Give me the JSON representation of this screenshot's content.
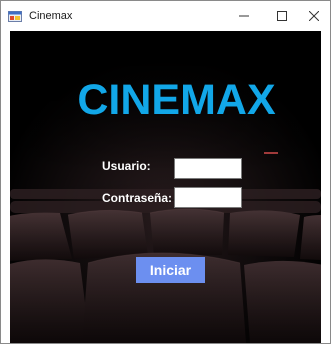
{
  "window": {
    "title": "Cinemax",
    "controls": [
      "minimize-icon",
      "maximize-icon",
      "close-icon"
    ]
  },
  "main": {
    "brand_title": "CINEMAX",
    "user_label": "Usuario:",
    "user_value": "",
    "password_label": "Contraseña:",
    "password_value": "",
    "submit_label": "Iniciar"
  },
  "colors": {
    "brand": "#12a7e8",
    "button_bg": "#6c8ff0",
    "background": "#000000",
    "seat": "#3a2a2c"
  }
}
